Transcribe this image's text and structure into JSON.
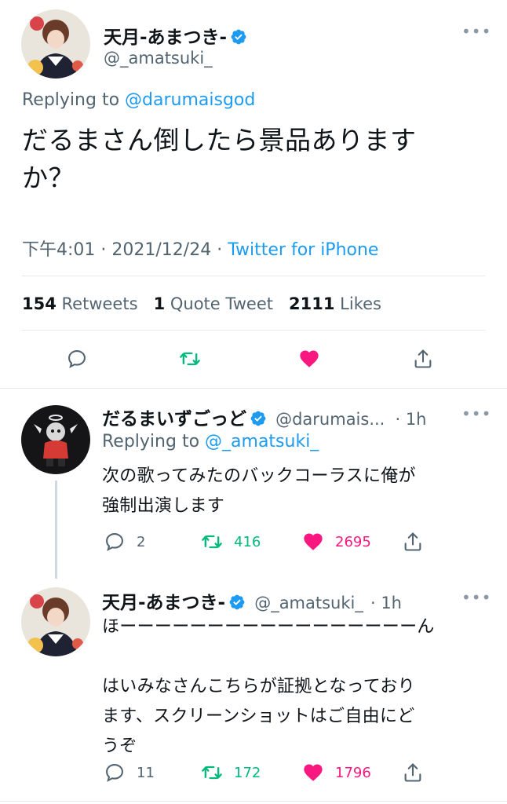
{
  "main_tweet": {
    "name": "天月-あまつき-",
    "handle": "@_amatsuki_",
    "replying_prefix": "Replying to ",
    "replying_to": "@darumaisgod",
    "text": "だるまさん倒したら景品ありますか？",
    "time": "下午4:01",
    "date": "2021/12/24",
    "source": "Twitter for iPhone",
    "separator": "·",
    "stats": {
      "retweets_count": "154",
      "retweets_label": "Retweets",
      "quotes_count": "1",
      "quotes_label": "Quote Tweet",
      "likes_count": "2111",
      "likes_label": "Likes"
    },
    "more": "•••"
  },
  "replies": [
    {
      "name": "だるまいずごっど",
      "handle": "@darumais...",
      "time": "· 1h",
      "replying_prefix": "Replying to ",
      "replying_to": "@_amatsuki_",
      "text_lines": [
        "次の歌ってみたのバックコーラスに俺が",
        "強制出演します"
      ],
      "replies": "2",
      "retweets": "416",
      "likes": "2695",
      "more": "•••"
    },
    {
      "name": "天月-あまつき-",
      "handle": "@_amatsuki_",
      "time": "· 1h",
      "text_lines": [
        "ほーーーーーーーーーーーーーーーーーん",
        "",
        "はいみなさんこちらが証拠となっており",
        "ます、スクリーンショットはご自由にど",
        "うぞ"
      ],
      "replies": "11",
      "retweets": "172",
      "likes": "1796",
      "more": "•••"
    }
  ],
  "colors": {
    "accent": "#1d9bf0",
    "retweet": "#00ba7c",
    "like": "#f91880",
    "muted": "#536471"
  },
  "icons": [
    "verified-badge-icon",
    "reply-icon",
    "retweet-icon",
    "heart-icon",
    "share-icon",
    "more-icon"
  ]
}
